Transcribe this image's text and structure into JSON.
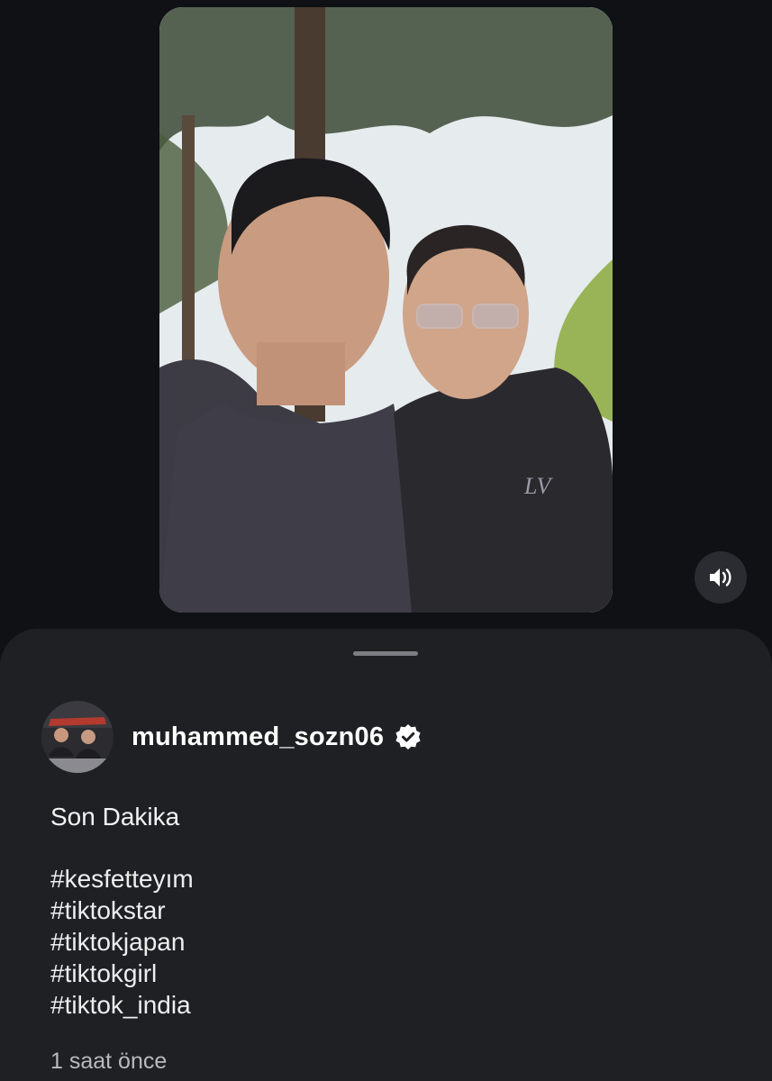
{
  "post": {
    "username": "muhammed_sozn06",
    "verified": true,
    "caption": "Son Dakika",
    "hashtags": [
      "#kesfetteyım",
      "#tiktokstar",
      "#tiktokjapan",
      "#tiktokgirl",
      "#tiktok_india"
    ],
    "timestamp": "1 saat önce"
  },
  "icons": {
    "sound": "speaker-volume-icon",
    "verified": "verified-badge-icon",
    "handle": "drag-handle"
  },
  "colors": {
    "page_bg": "#0f1114",
    "sheet_bg": "#1f2024",
    "text_primary": "#ffffff",
    "text_secondary": "#b9babd"
  }
}
